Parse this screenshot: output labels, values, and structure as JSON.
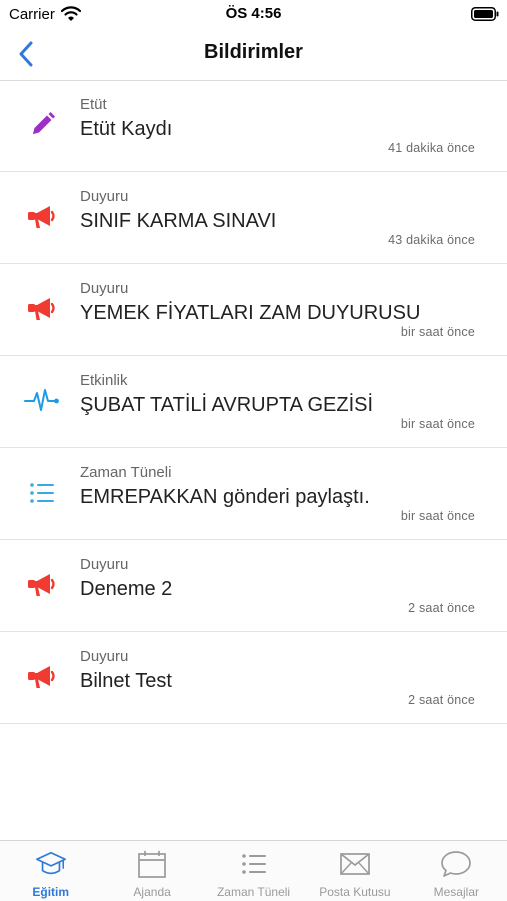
{
  "status_bar": {
    "carrier": "Carrier",
    "time": "ÖS 4:56"
  },
  "nav": {
    "title": "Bildirimler"
  },
  "notifications": [
    {
      "category": "Etüt",
      "title": "Etüt Kaydı",
      "time": "41 dakika önce",
      "icon": "pencil-icon",
      "color": "#9b30c4"
    },
    {
      "category": "Duyuru",
      "title": "SINIF KARMA SINAVI",
      "time": "43 dakika önce",
      "icon": "megaphone-icon",
      "color": "#f03a32"
    },
    {
      "category": "Duyuru",
      "title": "YEMEK FİYATLARI ZAM DUYURUSU",
      "time": "bir saat önce",
      "icon": "megaphone-icon",
      "color": "#f03a32"
    },
    {
      "category": "Etkinlik",
      "title": "ŞUBAT TATİLİ AVRUPTA GEZİSİ",
      "time": "bir saat önce",
      "icon": "activity-icon",
      "color": "#1e9be6"
    },
    {
      "category": "Zaman Tüneli",
      "title": "EMREPAKKAN gönderi paylaştı.",
      "time": "bir saat önce",
      "icon": "list-icon",
      "color": "#3aa9e8"
    },
    {
      "category": "Duyuru",
      "title": "Deneme 2",
      "time": "2 saat önce",
      "icon": "megaphone-icon",
      "color": "#f03a32"
    },
    {
      "category": "Duyuru",
      "title": "Bilnet Test",
      "time": "2 saat önce",
      "icon": "megaphone-icon",
      "color": "#f03a32"
    }
  ],
  "tabs": [
    {
      "label": "Eğitim",
      "icon": "graduation-cap-icon",
      "active": true
    },
    {
      "label": "Ajanda",
      "icon": "calendar-icon",
      "active": false
    },
    {
      "label": "Zaman Tüneli",
      "icon": "list-icon",
      "active": false
    },
    {
      "label": "Posta Kutusu",
      "icon": "envelope-icon",
      "active": false
    },
    {
      "label": "Mesajlar",
      "icon": "chat-bubble-icon",
      "active": false
    }
  ],
  "colors": {
    "accent": "#2f7ad8",
    "tab_inactive": "#9a9a9a"
  }
}
